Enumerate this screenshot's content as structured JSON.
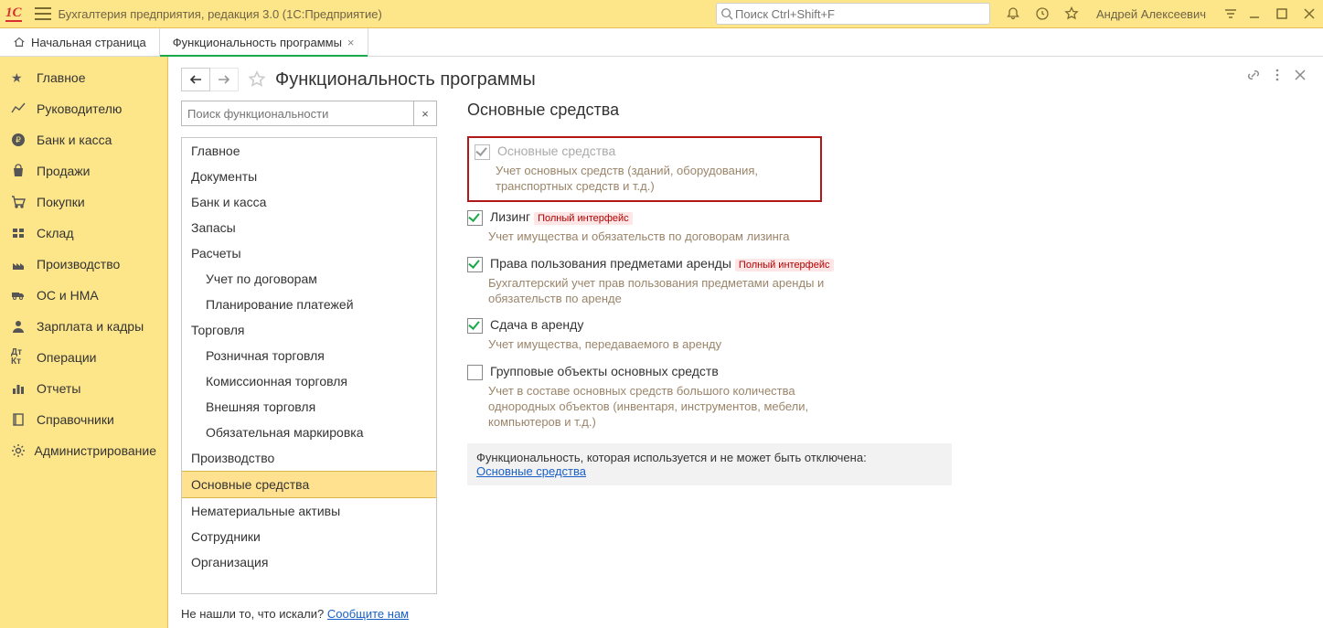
{
  "top": {
    "logo": "1C",
    "app_title": "Бухгалтерия предприятия, редакция 3.0  (1С:Предприятие)",
    "search_placeholder": "Поиск Ctrl+Shift+F",
    "user_name": "Андрей Алексеевич"
  },
  "tabs": {
    "home": "Начальная страница",
    "current": "Функциональность программы"
  },
  "sidebar": [
    {
      "id": "main",
      "label": "Главное"
    },
    {
      "id": "manager",
      "label": "Руководителю"
    },
    {
      "id": "bank",
      "label": "Банк и касса"
    },
    {
      "id": "sales",
      "label": "Продажи"
    },
    {
      "id": "purchases",
      "label": "Покупки"
    },
    {
      "id": "stock",
      "label": "Склад"
    },
    {
      "id": "production",
      "label": "Производство"
    },
    {
      "id": "os",
      "label": "ОС и НМА"
    },
    {
      "id": "salary",
      "label": "Зарплата и кадры"
    },
    {
      "id": "operations",
      "label": "Операции"
    },
    {
      "id": "reports",
      "label": "Отчеты"
    },
    {
      "id": "refs",
      "label": "Справочники"
    },
    {
      "id": "admin",
      "label": "Администрирование"
    }
  ],
  "page": {
    "title": "Функциональность программы",
    "search_placeholder": "Поиск функциональности",
    "tree": [
      {
        "label": "Главное",
        "sub": false
      },
      {
        "label": "Документы",
        "sub": false
      },
      {
        "label": "Банк и касса",
        "sub": false
      },
      {
        "label": "Запасы",
        "sub": false
      },
      {
        "label": "Расчеты",
        "sub": false
      },
      {
        "label": "Учет по договорам",
        "sub": true
      },
      {
        "label": "Планирование платежей",
        "sub": true
      },
      {
        "label": "Торговля",
        "sub": false
      },
      {
        "label": "Розничная торговля",
        "sub": true
      },
      {
        "label": "Комиссионная торговля",
        "sub": true
      },
      {
        "label": "Внешняя торговля",
        "sub": true
      },
      {
        "label": "Обязательная маркировка",
        "sub": true
      },
      {
        "label": "Производство",
        "sub": false
      },
      {
        "label": "Основные средства",
        "sub": false,
        "active": true
      },
      {
        "label": "Нематериальные активы",
        "sub": false
      },
      {
        "label": "Сотрудники",
        "sub": false
      },
      {
        "label": "Организация",
        "sub": false
      }
    ],
    "section_title": "Основные средства",
    "options": {
      "fixed_assets": {
        "label": "Основные средства",
        "desc": "Учет основных средств (зданий, оборудования, транспортных средств и т.д.)"
      },
      "leasing": {
        "label": "Лизинг",
        "badge": "Полный интерфейс",
        "desc": "Учет имущества и обязательств  по договорам лизинга"
      },
      "rent_rights": {
        "label": "Права пользования предметами аренды",
        "badge": "Полный интерфейс",
        "desc": "Бухгалтерский учет прав пользования предметами аренды и обязательств по аренде"
      },
      "rent_out": {
        "label": "Сдача в аренду",
        "desc": "Учет имущества, передаваемого в аренду"
      },
      "group_objects": {
        "label": "Групповые объекты основных средств",
        "desc": "Учет в составе основных средств большого количества однородных объектов (инвентаря, инструментов, мебели, компьютеров и т.д.)"
      }
    },
    "used_panel": {
      "text": "Функциональность, которая используется и не может быть отключена:",
      "link": "Основные средства"
    },
    "footer": {
      "text": "Не нашли то, что искали? ",
      "link": "Сообщите нам"
    }
  }
}
